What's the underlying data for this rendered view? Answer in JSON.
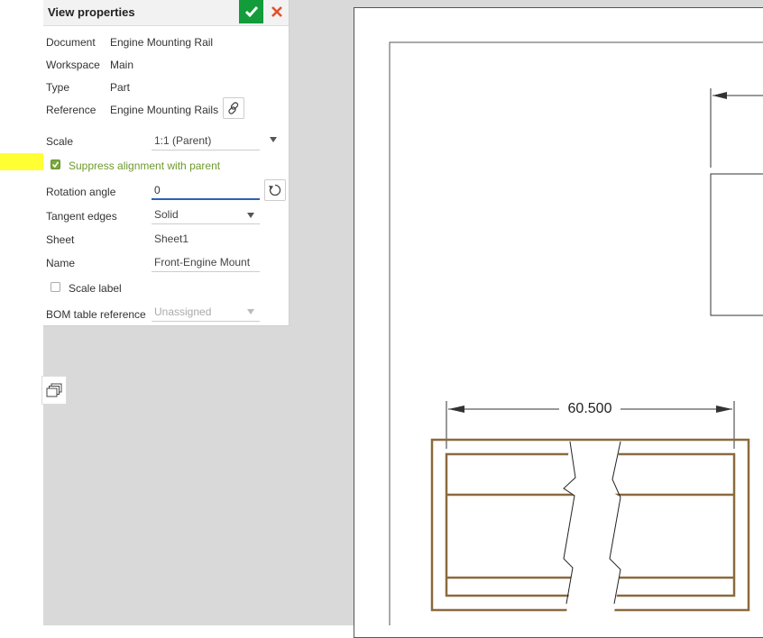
{
  "panel": {
    "title": "View properties",
    "rows": [
      {
        "label": "Document",
        "value": "Engine Mounting Rail"
      },
      {
        "label": "Workspace",
        "value": "Main"
      },
      {
        "label": "Type",
        "value": "Part"
      },
      {
        "label": "Reference",
        "value": "Engine Mounting Rails"
      }
    ],
    "scale": {
      "label": "Scale",
      "value": "1:1 (Parent)"
    },
    "suppress_alignment": {
      "label": "Suppress alignment with parent",
      "checked": true
    },
    "rotation": {
      "label": "Rotation angle",
      "value": "0"
    },
    "tangent_edges": {
      "label": "Tangent edges",
      "value": "Solid"
    },
    "sheet": {
      "label": "Sheet",
      "value": "Sheet1"
    },
    "name": {
      "label": "Name",
      "value": "Front-Engine Mount"
    },
    "scale_label": {
      "label": "Scale label",
      "checked": false
    },
    "bom": {
      "label": "BOM table reference",
      "value": "Unassigned"
    }
  },
  "drawing": {
    "dimension": "60.500"
  },
  "colors": {
    "confirm": "#139c3a",
    "cancel": "#e0522b",
    "highlight": "#ffff33",
    "part_outline": "#8b6a3e",
    "input_focus": "#2b62b3"
  },
  "icons": [
    "check-icon",
    "close-icon",
    "link-icon",
    "reset-rotation-icon",
    "stacked-views-icon",
    "dropdown-arrow-icon"
  ]
}
